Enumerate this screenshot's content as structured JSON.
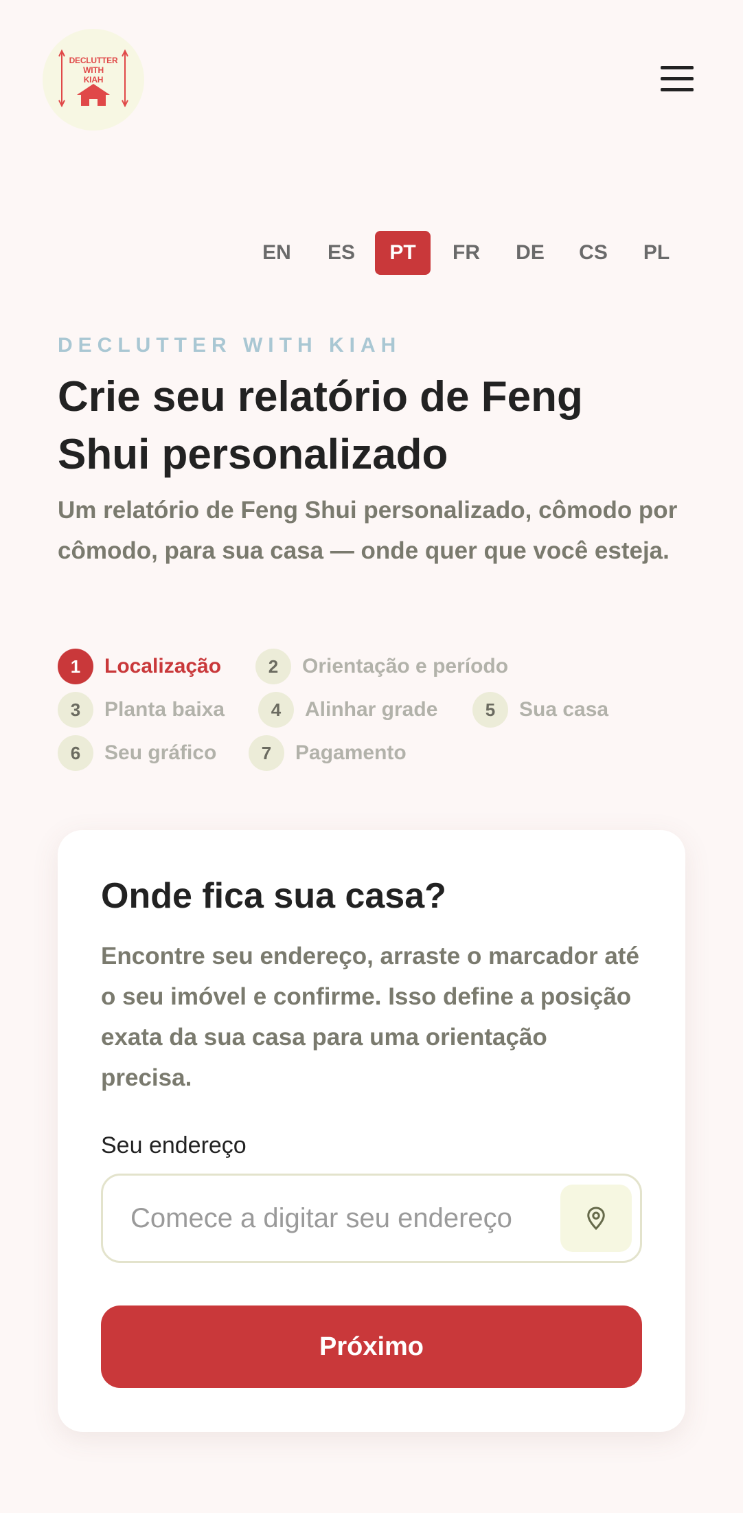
{
  "header": {
    "logo": {
      "line1": "DECLUTTER",
      "line2": "WITH",
      "line3": "KIAH"
    },
    "menu_icon": "hamburger-icon"
  },
  "languages": {
    "items": [
      "EN",
      "ES",
      "PT",
      "FR",
      "DE",
      "CS",
      "PL"
    ],
    "active": "PT"
  },
  "hero": {
    "eyebrow": "DECLUTTER WITH KIAH",
    "title": "Crie seu relatório de Feng Shui personalizado",
    "subtitle": "Um relatório de Feng Shui personalizado, cômodo por cômodo, para sua casa — onde quer que você esteja."
  },
  "steps": [
    {
      "num": "1",
      "label": "Localização",
      "active": true
    },
    {
      "num": "2",
      "label": "Orientação e período",
      "active": false
    },
    {
      "num": "3",
      "label": "Planta baixa",
      "active": false
    },
    {
      "num": "4",
      "label": "Alinhar grade",
      "active": false
    },
    {
      "num": "5",
      "label": "Sua casa",
      "active": false
    },
    {
      "num": "6",
      "label": "Seu gráfico",
      "active": false
    },
    {
      "num": "7",
      "label": "Pagamento",
      "active": false
    }
  ],
  "card": {
    "title": "Onde fica sua casa?",
    "description": "Encontre seu endereço, arraste o marcador até o seu imóvel e confirme. Isso define a posição exata da sua casa para uma orientação precisa.",
    "address_label": "Seu endereço",
    "address_placeholder": "Comece a digitar seu endereço",
    "address_value": "",
    "locate_icon": "map-pin-icon",
    "next_label": "Próximo"
  },
  "colors": {
    "accent": "#c9383a",
    "background": "#fdf7f6",
    "eyebrow": "#a9c7d3",
    "muted_text": "#7a7a6e"
  }
}
